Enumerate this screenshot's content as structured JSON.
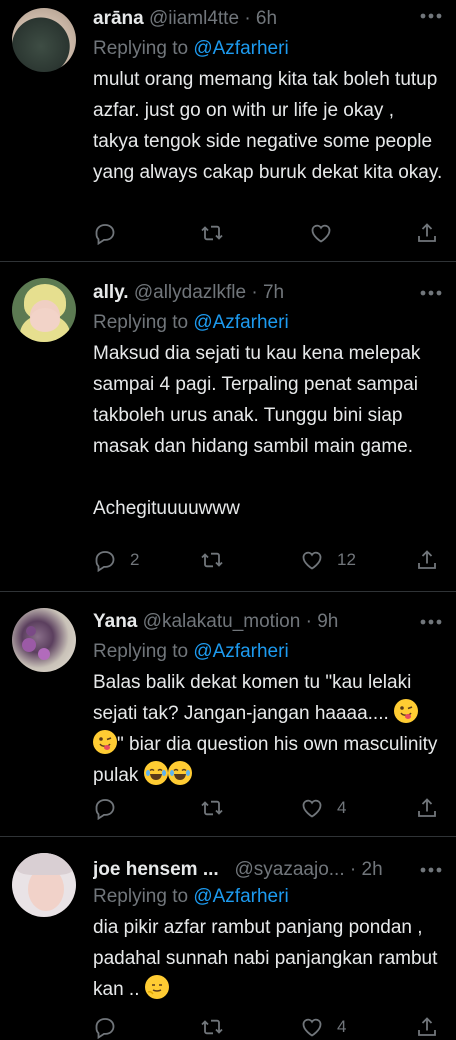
{
  "tweets": [
    {
      "name": "arāna",
      "handle": "@iiaml4tte",
      "time": "6h",
      "replying_prefix": "Replying to",
      "replying_to": "@Azfarheri",
      "text": "mulut orang memang kita tak boleh tutup azfar. just go on with ur life je okay , takya tengok side negative some people yang always cakap buruk dekat kita okay.",
      "replies": "",
      "retweets": "",
      "likes": ""
    },
    {
      "name": "ally.",
      "handle": "@allydazlkfle",
      "time": "7h",
      "replying_prefix": "Replying to",
      "replying_to": "@Azfarheri",
      "text": "Maksud dia sejati tu kau kena melepak sampai 4 pagi. Terpaling penat sampai takboleh urus anak. Tunggu bini siap masak dan hidang sambil main game.\n\nAchegituuuuwww",
      "replies": "2",
      "retweets": "",
      "likes": "12"
    },
    {
      "name": "Yana",
      "handle": "@kalakatu_motion",
      "time": "9h",
      "replying_prefix": "Replying to",
      "replying_to": "@Azfarheri",
      "text_part1": "Balas balik dekat komen tu \"kau lelaki sejati tak? Jangan-jangan haaaa....",
      "text_part2": "\" biar dia question his own masculinity pulak",
      "replies": "",
      "retweets": "",
      "likes": "4"
    },
    {
      "name": "joe hensem ...",
      "handle": "@syazaajo...",
      "time": "2h",
      "replying_prefix": "Replying to",
      "replying_to": "@Azfarheri",
      "text": "dia pikir azfar rambut panjang pondan , padahal sunnah nabi panjangkan rambut kan .. ",
      "replies": "",
      "retweets": "",
      "likes": "4"
    }
  ],
  "separator": "·",
  "colors": {
    "background": "#000000",
    "text": "#e7e9ea",
    "secondary": "#71767b",
    "accent": "#1d9bf0",
    "divider": "#2f3336"
  },
  "icons": [
    "reply-icon",
    "retweet-icon",
    "like-icon",
    "share-icon",
    "more-icon",
    "wink-tongue-emoji",
    "tears-of-joy-emoji",
    "smile-emoji"
  ]
}
